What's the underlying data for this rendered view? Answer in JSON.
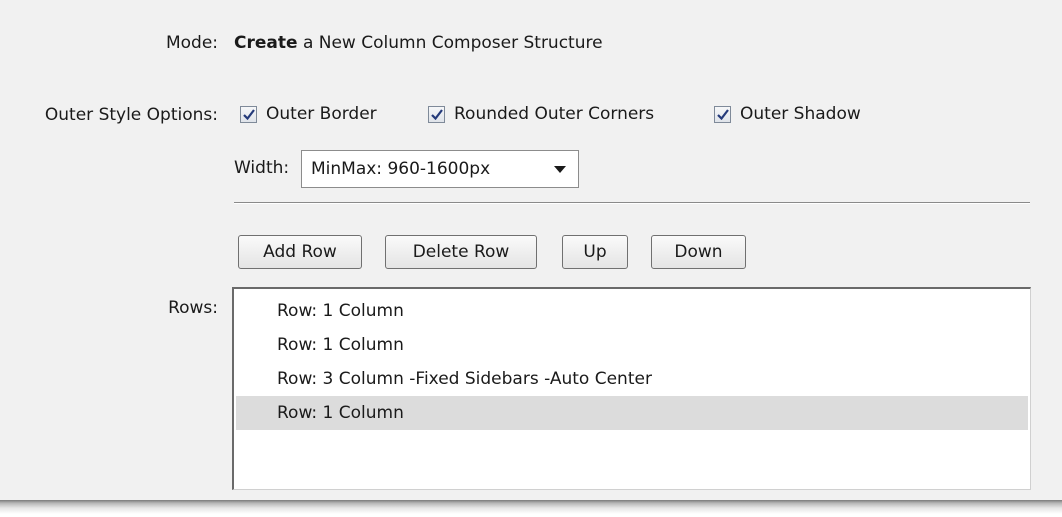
{
  "mode": {
    "label": "Mode:",
    "action": "Create",
    "rest": "a New Column Composer Structure"
  },
  "outer_style": {
    "label": "Outer Style Options:",
    "options": [
      {
        "label": "Outer Border",
        "checked": true
      },
      {
        "label": "Rounded Outer Corners",
        "checked": true
      },
      {
        "label": "Outer Shadow",
        "checked": true
      }
    ],
    "width_label": "Width:",
    "width_value": "MinMax: 960-1600px"
  },
  "buttons": {
    "add_row": "Add Row",
    "delete_row": "Delete Row",
    "up": "Up",
    "down": "Down"
  },
  "rows": {
    "label": "Rows:",
    "items": [
      {
        "label": "Row: 1 Column",
        "selected": false
      },
      {
        "label": "Row: 1 Column",
        "selected": false
      },
      {
        "label": "Row: 3 Column -Fixed Sidebars -Auto Center",
        "selected": false
      },
      {
        "label": "Row: 1 Column",
        "selected": true
      }
    ]
  },
  "colors": {
    "panel_bg": "#f1f1f1",
    "selected_row": "#dcdcdc",
    "check_mark": "#243a7a"
  }
}
